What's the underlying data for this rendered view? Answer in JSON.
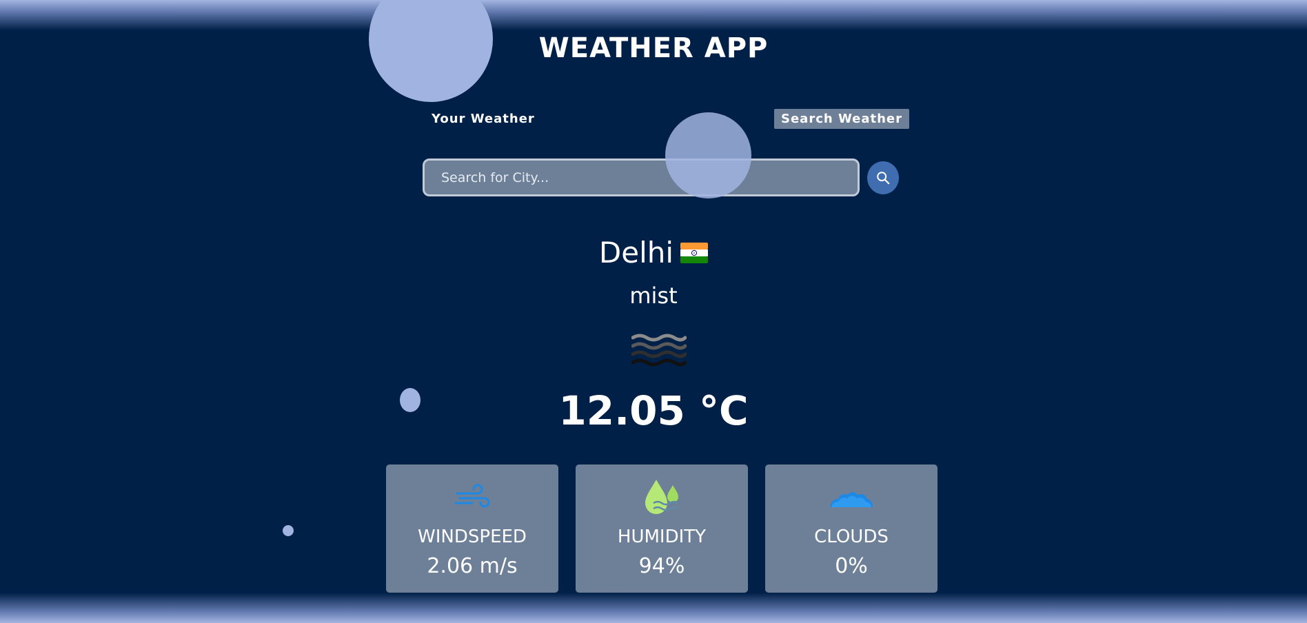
{
  "app": {
    "title": "WEATHER APP"
  },
  "tabs": {
    "your_weather": "Your Weather",
    "search_weather": "Search Weather"
  },
  "search": {
    "placeholder": "Search for City..."
  },
  "location": {
    "city": "Delhi",
    "flag": "india-flag-icon"
  },
  "conditions": {
    "description": "mist",
    "icon": "mist-icon",
    "temperature": "12.05 °C"
  },
  "stats": [
    {
      "label": "WINDSPEED",
      "value": "2.06 m/s",
      "icon": "wind-icon"
    },
    {
      "label": "HUMIDITY",
      "value": "94%",
      "icon": "humidity-icon"
    },
    {
      "label": "CLOUDS",
      "value": "0%",
      "icon": "clouds-icon"
    }
  ],
  "colors": {
    "background": "#002047",
    "panel": "#6e8098",
    "bubble": "#a1b4e1",
    "search_button": "#3f6db0"
  }
}
